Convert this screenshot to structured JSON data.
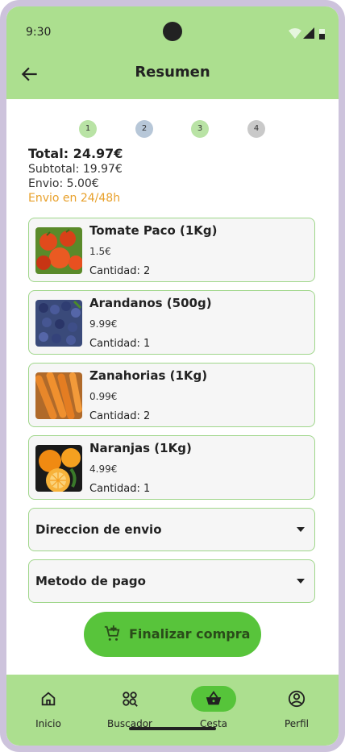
{
  "status_bar": {
    "time": "9:30"
  },
  "app_bar": {
    "title": "Resumen"
  },
  "stepper": {
    "steps": [
      "1",
      "2",
      "3",
      "4"
    ]
  },
  "summary": {
    "total": "Total: 24.97€",
    "subtotal": "Subtotal: 19.97€",
    "shipping": "Envio: 5.00€",
    "delivery_time": "Envio en 24/48h"
  },
  "items": [
    {
      "name": "Tomate Paco (1Kg)",
      "price": "1.5€",
      "quantity": "Cantidad: 2"
    },
    {
      "name": "Arandanos (500g)",
      "price": "9.99€",
      "quantity": "Cantidad: 1"
    },
    {
      "name": "Zanahorias (1Kg)",
      "price": "0.99€",
      "quantity": "Cantidad: 2"
    },
    {
      "name": "Naranjas (1Kg)",
      "price": "4.99€",
      "quantity": "Cantidad: 1"
    }
  ],
  "selects": {
    "address": "Direccion de envio",
    "payment": "Metodo de pago"
  },
  "actions": {
    "finalize": "Finalizar compra"
  },
  "bottom_nav": {
    "inicio": "Inicio",
    "buscador": "Buscador",
    "cesta": "Cesta",
    "perfil": "Perfil"
  },
  "colors": {
    "app_bar": "#acdf8f",
    "accent": "#58c43b",
    "card_border": "#9fd68a",
    "delivery_text": "#e8a02a"
  }
}
